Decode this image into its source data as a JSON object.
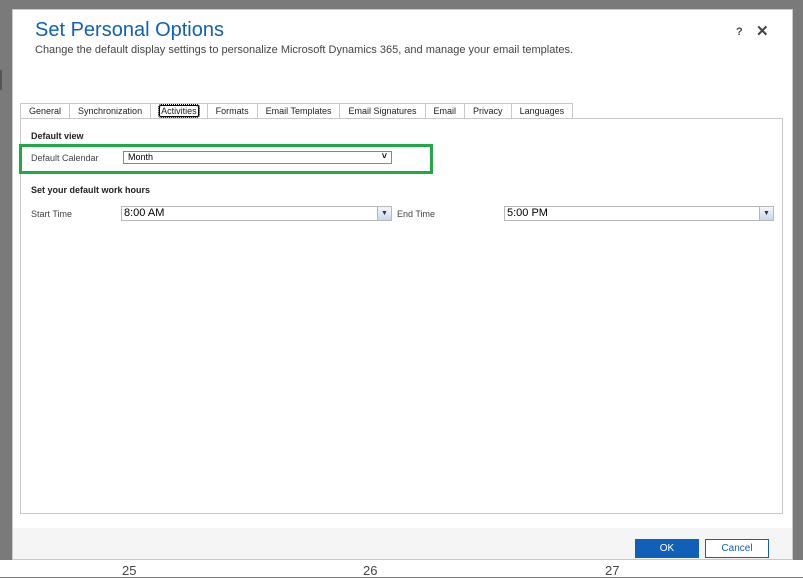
{
  "dialog": {
    "title": "Set Personal Options",
    "subtitle": "Change the default display settings to personalize Microsoft Dynamics 365, and manage your email templates.",
    "help_label": "?",
    "close_label": "✕"
  },
  "tabs": [
    {
      "label": "General"
    },
    {
      "label": "Synchronization"
    },
    {
      "label": "Activities"
    },
    {
      "label": "Formats"
    },
    {
      "label": "Email Templates"
    },
    {
      "label": "Email Signatures"
    },
    {
      "label": "Email"
    },
    {
      "label": "Privacy"
    },
    {
      "label": "Languages"
    }
  ],
  "active_tab": "Activities",
  "default_view": {
    "heading": "Default view",
    "calendar_label": "Default Calendar",
    "calendar_value": "Month"
  },
  "work_hours": {
    "heading": "Set your default work hours",
    "start_label": "Start Time",
    "start_value": "8:00 AM",
    "end_label": "End Time",
    "end_value": "5:00 PM"
  },
  "footer": {
    "ok_label": "OK",
    "cancel_label": "Cancel"
  },
  "background": {
    "dates": [
      "25",
      "26",
      "27"
    ]
  },
  "colors": {
    "accent": "#1160b7",
    "highlight": "#22a845"
  }
}
